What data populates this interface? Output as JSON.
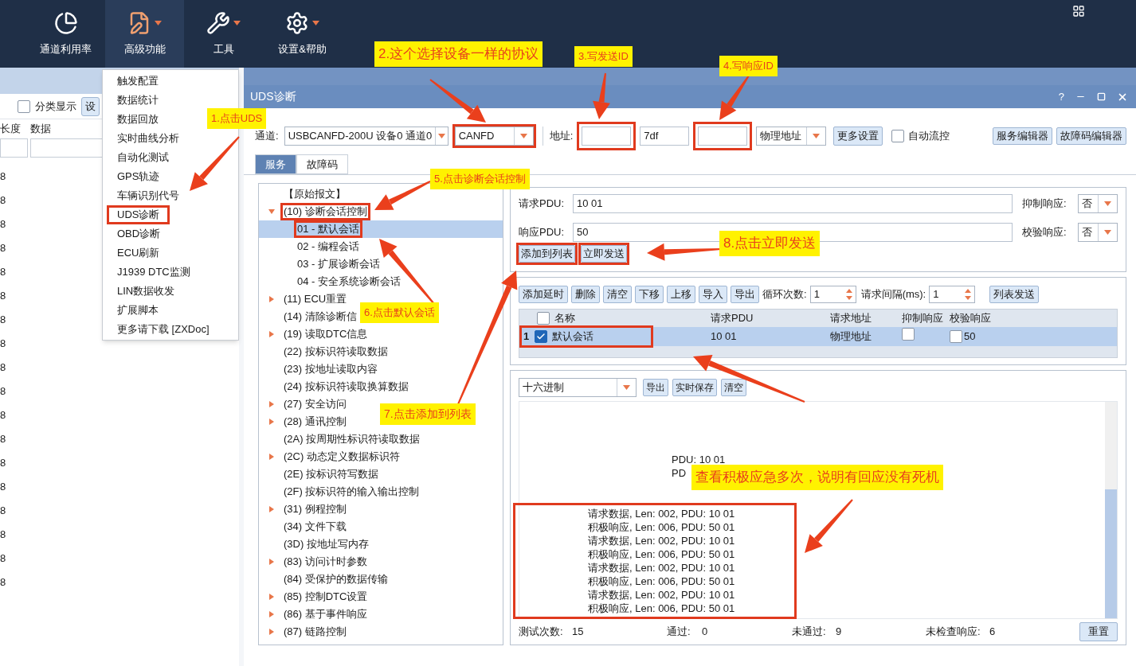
{
  "toolbar": {
    "items": [
      {
        "label": "通道利用率",
        "kind": "chart",
        "selected": false,
        "menu": false
      },
      {
        "label": "高级功能",
        "kind": "edit",
        "selected": true,
        "menu": true
      },
      {
        "label": "工具",
        "kind": "tools",
        "selected": false,
        "menu": true
      },
      {
        "label": "设置&帮助",
        "kind": "gear",
        "selected": false,
        "menu": true
      }
    ]
  },
  "left_pane": {
    "class_display": {
      "label": "分类显示",
      "checked": false
    },
    "settings_button": "设",
    "columns": [
      "长度",
      "数据"
    ],
    "rows": [
      {
        "length": "8"
      },
      {
        "length": "8"
      },
      {
        "length": "8"
      },
      {
        "length": "8"
      },
      {
        "length": "8"
      },
      {
        "length": "8"
      },
      {
        "length": "8"
      },
      {
        "length": "8"
      },
      {
        "length": "8"
      },
      {
        "length": "8"
      },
      {
        "length": "8"
      },
      {
        "length": "8"
      },
      {
        "length": "8"
      },
      {
        "length": "8"
      },
      {
        "length": "8"
      },
      {
        "length": "8"
      },
      {
        "length": "8"
      },
      {
        "length": "8"
      }
    ]
  },
  "menu": {
    "items": [
      {
        "label": "触发配置",
        "highlighted": false
      },
      {
        "label": "数据统计",
        "highlighted": false
      },
      {
        "label": "数据回放",
        "highlighted": false
      },
      {
        "label": "实时曲线分析",
        "highlighted": false
      },
      {
        "label": "自动化测试",
        "highlighted": false
      },
      {
        "label": "GPS轨迹",
        "highlighted": false
      },
      {
        "label": "车辆识别代号",
        "highlighted": false
      },
      {
        "label": "UDS诊断",
        "highlighted": true
      },
      {
        "label": "OBD诊断",
        "highlighted": false
      },
      {
        "label": "ECU刷新",
        "highlighted": false
      },
      {
        "label": "J1939 DTC监测",
        "highlighted": false
      },
      {
        "label": "LIN数据收发",
        "highlighted": false
      },
      {
        "label": "扩展脚本",
        "highlighted": false
      },
      {
        "label": "更多请下载 [ZXDoc]",
        "highlighted": false
      }
    ]
  },
  "uds": {
    "title": "UDS诊断",
    "help": "?",
    "channel_label": "通道:",
    "channel": "USBCANFD-200U 设备0 通道0",
    "protocol": {
      "value": "CANFD",
      "highlighted": true
    },
    "address_label": "地址:",
    "request_id": {
      "highlighted": true
    },
    "functional_id": "7df",
    "response_id": {
      "highlighted": true
    },
    "address_type": "物理地址",
    "more_settings": "更多设置",
    "auto_flow": {
      "label": "自动流控",
      "checked": false
    },
    "editors": [
      "服务编辑器",
      "故障码编辑器"
    ],
    "tabs": [
      {
        "label": "服务",
        "selected": true
      },
      {
        "label": "故障码",
        "selected": false
      }
    ],
    "tree": [
      {
        "label": "【原始报文】"
      },
      {
        "label": "(10) 诊断会话控制",
        "expanded": true,
        "highlighted": true,
        "children": [
          {
            "label": "01 - 默认会话",
            "selected": true,
            "highlighted": true
          },
          {
            "label": "02 - 编程会话",
            "selected": false,
            "highlighted": false
          },
          {
            "label": "03 - 扩展诊断会话",
            "selected": false,
            "highlighted": false
          },
          {
            "label": "04 - 安全系统诊断会话",
            "selected": false,
            "highlighted": false
          }
        ]
      },
      {
        "label": "(11) ECU重置",
        "expanded": false
      },
      {
        "label": "(14) 清除诊断信"
      },
      {
        "label": "(19) 读取DTC信息",
        "expanded": false
      },
      {
        "label": "(22) 按标识符读取数据"
      },
      {
        "label": "(23) 按地址读取内容"
      },
      {
        "label": "(24) 按标识符读取换算数据"
      },
      {
        "label": "(27) 安全访问",
        "expanded": false
      },
      {
        "label": "(28) 通讯控制",
        "expanded": false
      },
      {
        "label": "(2A) 按周期性标识符读取数据"
      },
      {
        "label": "(2C) 动态定义数据标识符",
        "expanded": false
      },
      {
        "label": "(2E) 按标识符写数据"
      },
      {
        "label": "(2F) 按标识符的输入输出控制"
      },
      {
        "label": "(31) 例程控制",
        "expanded": false
      },
      {
        "label": "(34) 文件下载"
      },
      {
        "label": "(3D) 按地址写内存"
      },
      {
        "label": "(83) 访问计时参数",
        "expanded": false
      },
      {
        "label": "(84) 受保护的数据传输"
      },
      {
        "label": "(85) 控制DTC设置",
        "expanded": false
      },
      {
        "label": "(86) 基于事件响应",
        "expanded": false
      },
      {
        "label": "(87) 链路控制",
        "expanded": false
      }
    ],
    "request": {
      "request_label": "请求PDU:",
      "request_value": "10 01",
      "suppress_label": "抑制响应:",
      "suppress_value": "否",
      "response_label": "响应PDU:",
      "response_value": "50",
      "verify_label": "校验响应:",
      "verify_value": "否",
      "buttons": [
        {
          "label": "添加到列表",
          "highlighted": true
        },
        {
          "label": "立即发送",
          "highlighted": true
        }
      ]
    },
    "list": {
      "buttons": [
        "添加延时",
        "删除",
        "清空",
        "下移",
        "上移",
        "导入",
        "导出"
      ],
      "loop_label": "循环次数:",
      "loop_value": "1",
      "interval_label": "请求间隔(ms):",
      "interval_value": "1",
      "send_button": "列表发送",
      "all_checked": false,
      "columns": [
        "名称",
        "请求PDU",
        "请求地址",
        "抑制响应",
        "校验响应"
      ],
      "rows": [
        {
          "index": "1",
          "checked": true,
          "selected": true,
          "highlighted": true,
          "name": "默认会话",
          "pdu": "10 01",
          "address": "物理地址",
          "suppress": false,
          "verify": false,
          "verify_value": "50"
        }
      ]
    },
    "log": {
      "format": "十六进制",
      "buttons": [
        "导出",
        "实时保存",
        "清空"
      ],
      "blocks": [
        {
          "highlighted": false,
          "lines": [
            "PDU: 10 01",
            "PD"
          ]
        },
        {
          "highlighted": true,
          "lines": [
            "请求数据, Len: 002, PDU: 10 01",
            "积极响应, Len: 006, PDU: 50 01",
            "请求数据, Len: 002, PDU: 10 01",
            "积极响应, Len: 006, PDU: 50 01",
            "请求数据, Len: 002, PDU: 10 01",
            "积极响应, Len: 006, PDU: 50 01",
            "请求数据, Len: 002, PDU: 10 01",
            "积极响应, Len: 006, PDU: 50 01"
          ]
        }
      ],
      "stats": [
        {
          "label": "测试次数:",
          "value": "15"
        },
        {
          "label": "通过:",
          "value": "0"
        },
        {
          "label": "未通过:",
          "value": "9"
        },
        {
          "label": "未检查响应:",
          "value": "6"
        }
      ],
      "reset": "重置"
    }
  },
  "annotations": [
    {
      "text": "1.点击UDS"
    },
    {
      "text": "2.这个选择设备一样的协议"
    },
    {
      "text": "3.写发送ID"
    },
    {
      "text": "4.写响应ID"
    },
    {
      "text": "5.点击诊断会话控制"
    },
    {
      "text": "6.点击默认会话"
    },
    {
      "text": "7.点击添加到列表"
    },
    {
      "text": "8.点击立即发送"
    },
    {
      "text": "查看积极应急多次，说明有回应没有死机"
    }
  ]
}
